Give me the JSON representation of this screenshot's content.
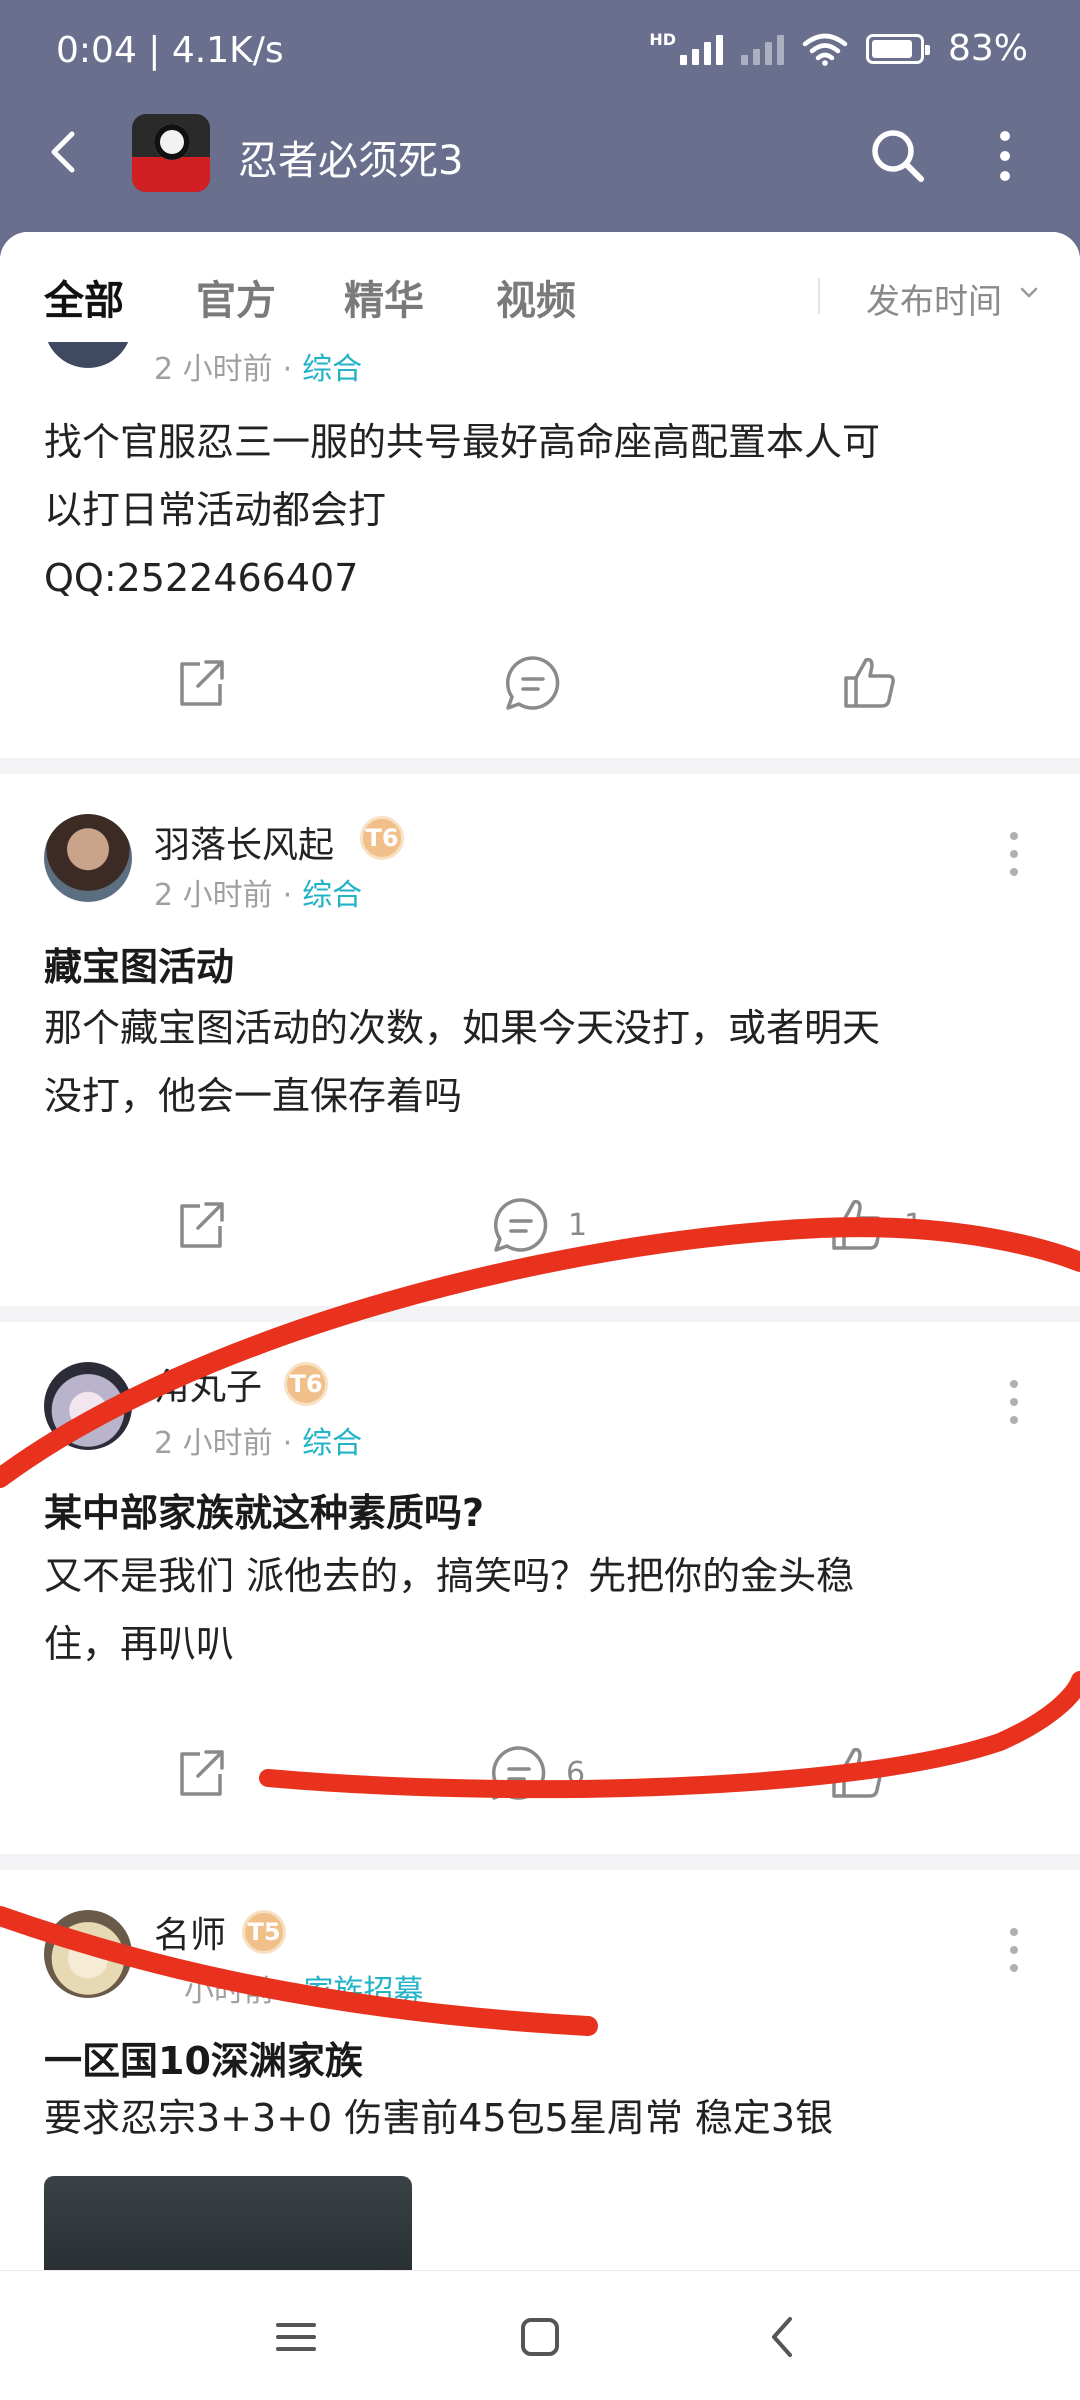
{
  "status_bar": {
    "time_speed": "0:04 | 4.1K/s",
    "network_badge": "HD",
    "battery": "83%"
  },
  "app_bar": {
    "title": "忍者必须死3",
    "icons": [
      "back-arrow-icon",
      "search-icon",
      "more-vertical-icon"
    ]
  },
  "tabs": {
    "items": [
      "全部",
      "官方",
      "精华",
      "视频"
    ],
    "active": "全部",
    "sort_label": "发布时间"
  },
  "posts": [
    {
      "time": "2 小时前",
      "category": "综合",
      "body_lines": [
        "找个官服忍三一服的共号最好高命座高配置本人可",
        "以打日常活动都会打",
        "QQ:2522466407"
      ],
      "comments": "",
      "likes": ""
    },
    {
      "user": "羽落长风起",
      "level": "T6",
      "time": "2 小时前",
      "category": "综合",
      "title": "藏宝图活动",
      "body_lines": [
        "那个藏宝图活动的次数，如果今天没打，或者明天",
        "没打，他会一直保存着吗"
      ],
      "comments": "1",
      "likes": "1"
    },
    {
      "user": "角丸子",
      "level": "T6",
      "time": "2 小时前",
      "category": "综合",
      "title": "某中部家族就这种素质吗?",
      "body_lines": [
        "又不是我们 派他去的，搞笑吗？先把你的金头稳",
        "住，再叭叭"
      ],
      "comments": "6",
      "likes": ""
    },
    {
      "user": "名师",
      "level": "T5",
      "time": "小时前",
      "category": "家族招募",
      "title": "一区国10深渊家族",
      "body_lines": [
        "要求忍宗3+3+0 伤害前45包5星周常 稳定3银"
      ]
    }
  ],
  "annotation_color": "#e8321e",
  "accent_color": "#22b3c8",
  "header_color": "#6b6f8e"
}
